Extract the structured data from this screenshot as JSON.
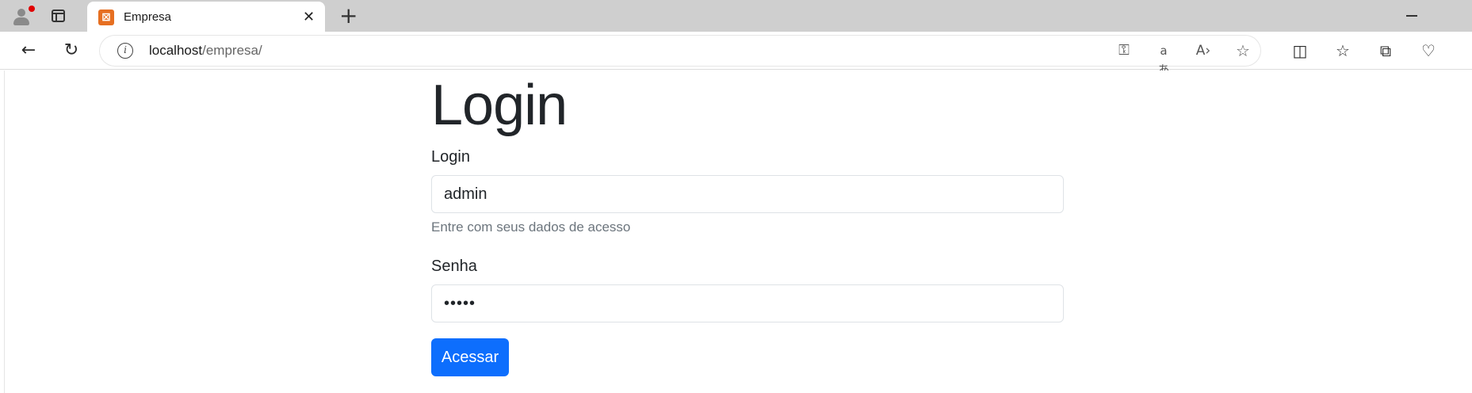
{
  "browser": {
    "tab": {
      "title": "Empresa",
      "favicon": "xampp-icon"
    },
    "newtab_icon": "plus-icon",
    "close_icon": "close-icon",
    "minimize_icon": "minimize-icon",
    "address": {
      "host": "localhost",
      "path": "/empresa/"
    },
    "toolbar_icons": [
      "back-icon",
      "refresh-icon",
      "key-icon",
      "translate-icon",
      "read-aloud-icon",
      "favorite-star-icon",
      "split-screen-icon",
      "favorites-icon",
      "collections-icon",
      "browser-essentials-icon"
    ]
  },
  "page": {
    "title": "Login",
    "login_label": "Login",
    "login_value": "admin",
    "help_text": "Entre com seus dados de acesso",
    "password_label": "Senha",
    "password_value": "•••••",
    "submit_label": "Acessar"
  },
  "colors": {
    "primary": "#0d6efd",
    "text": "#212529",
    "muted": "#6c757d",
    "border": "#dee2e6"
  }
}
